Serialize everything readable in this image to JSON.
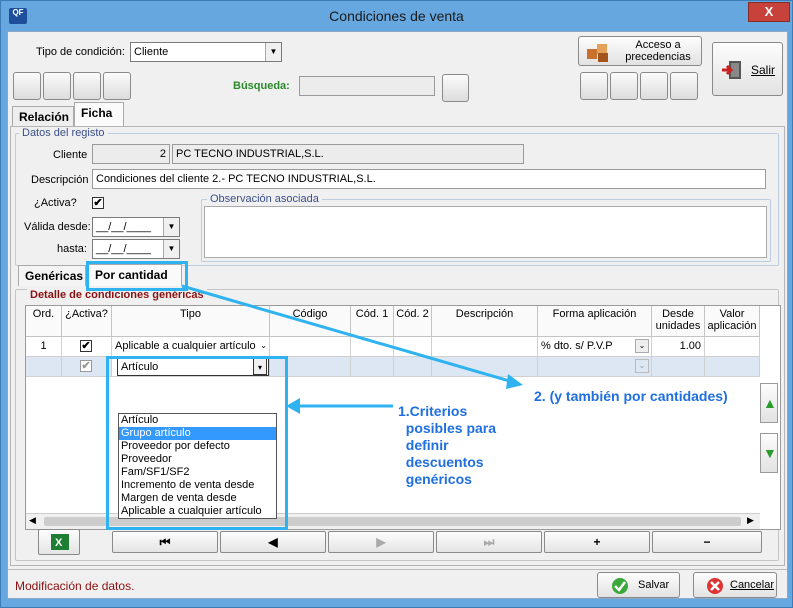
{
  "window": {
    "title": "Condiciones de venta",
    "app_icon": "QF",
    "close_label": "X"
  },
  "header": {
    "tipo_label": "Tipo de condición:",
    "tipo_value": "Cliente",
    "acceso_label": "Acceso a\nprecedencias",
    "salir_label": "Salir",
    "busqueda_label": "Búsqueda:",
    "busqueda_value": ""
  },
  "tabs": {
    "relacion": "Relación",
    "ficha": "Ficha"
  },
  "registro": {
    "legend": "Datos del registo",
    "cliente_label": "Cliente",
    "cliente_code": "2",
    "cliente_name": "PC TECNO INDUSTRIAL,S.L.",
    "descripcion_label": "Descripción",
    "descripcion_value": "Condiciones del cliente 2.- PC TECNO INDUSTRIAL,S.L.",
    "activa_label": "¿Activa?",
    "activa_checked": "✔",
    "valida_label": "Válida desde:",
    "valida_value": "__/__/____",
    "hasta_label": "hasta:",
    "hasta_value": "__/__/____",
    "observacion_legend": "Observación asociada"
  },
  "subtabs": {
    "genericas": "Genéricas",
    "cantidad": "Por cantidad"
  },
  "detalle": {
    "legend": "Detalle de condiciones genéricas",
    "columns": [
      "Ord.",
      "¿Activa?",
      "Tipo",
      "Código",
      "Cód. 1",
      "Cód. 2",
      "Descripción",
      "Forma aplicación",
      "Desde\nunidades",
      "Valor\naplicación"
    ],
    "rows": [
      {
        "ord": "1",
        "activa": "✔",
        "tipo": "Aplicable a cualquier artículo",
        "forma": "% dto. s/ P.V.P",
        "desde": "1.00"
      }
    ],
    "edit_row": {
      "activa": "✔",
      "tipo": "Artículo"
    }
  },
  "dropdown_options": [
    "Artículo",
    "Grupo artículo",
    "Proveedor por defecto",
    "Proveedor",
    "Fam/SF1/SF2",
    "Incremento de venta desde",
    "Margen de venta desde",
    "Aplicable a cualquier artículo"
  ],
  "dropdown_selected_index": 1,
  "annotations": {
    "one": "1.Criterios\n  posibles para\n  definir\n  descuentos\n  genéricos",
    "two": "2. (y también por cantidades)"
  },
  "nav": {
    "first": "⏮",
    "prev": "◀",
    "next": "▶",
    "last": "⏭",
    "add": "+",
    "remove": "−"
  },
  "footer": {
    "status": "Modificación de datos.",
    "save_label": "Salvar",
    "cancel_label": "Cancelar"
  },
  "colors": {
    "titlebar": "#66a7e0",
    "accent": "#2fb3f0",
    "annotation": "#1f6fe0",
    "status_text": "#8b1010",
    "selection": "#3399ff"
  }
}
